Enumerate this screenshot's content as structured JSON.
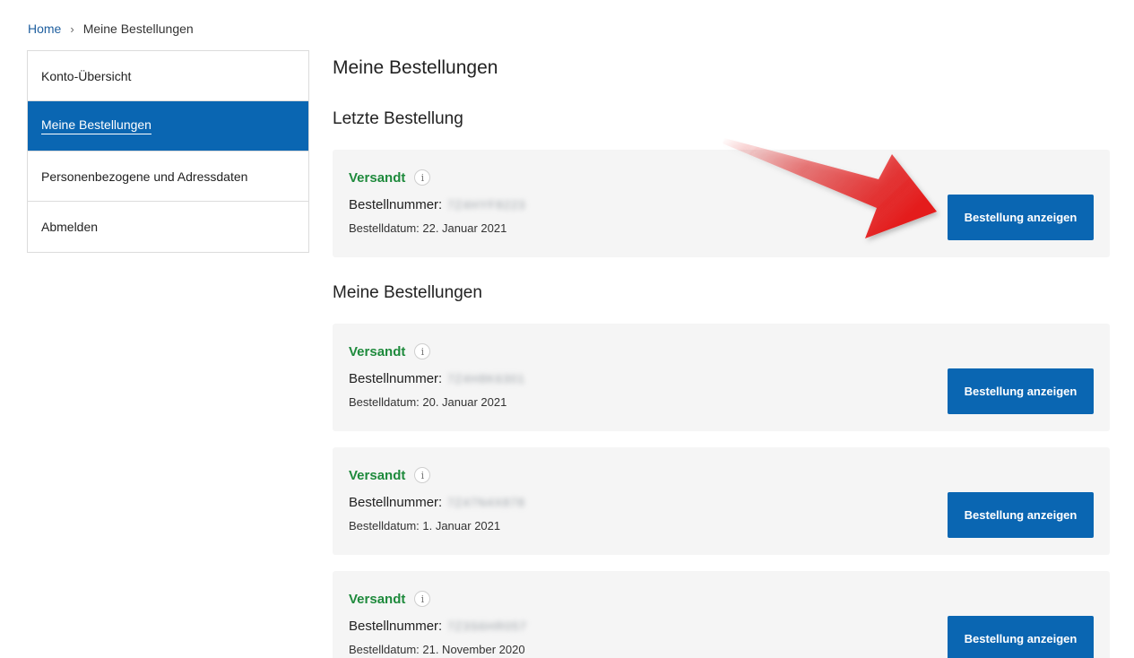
{
  "breadcrumb": {
    "home": "Home",
    "separator": "›",
    "current": "Meine Bestellungen"
  },
  "sidebar": {
    "items": [
      {
        "label": "Konto-Übersicht",
        "active": false
      },
      {
        "label": "Meine Bestellungen",
        "active": true
      },
      {
        "label": "Personenbezogene und Adressdaten",
        "active": false
      },
      {
        "label": "Abmelden",
        "active": false
      }
    ]
  },
  "main": {
    "title": "Meine Bestellungen",
    "latest_section_title": "Letzte Bestellung",
    "orders_section_title": "Meine Bestellungen",
    "latest_order": {
      "status": "Versandt",
      "number_label": "Bestellnummer:",
      "number_value": "7Z4HYF8223",
      "date": "Bestelldatum: 22. Januar 2021",
      "button_label": "Bestellung anzeigen"
    },
    "orders": [
      {
        "status": "Versandt",
        "number_label": "Bestellnummer:",
        "number_value": "7Z4H8K6301",
        "date": "Bestelldatum: 20. Januar 2021",
        "button_label": "Bestellung anzeigen"
      },
      {
        "status": "Versandt",
        "number_label": "Bestellnummer:",
        "number_value": "7Z47N4X878",
        "date": "Bestelldatum: 1. Januar 2021",
        "button_label": "Bestellung anzeigen"
      },
      {
        "status": "Versandt",
        "number_label": "Bestellnummer:",
        "number_value": "7Z3S6HR057",
        "date": "Bestelldatum: 21. November 2020",
        "button_label": "Bestellung anzeigen"
      }
    ]
  },
  "icons": {
    "info": "info-icon",
    "annotation": "red-arrow-icon"
  },
  "colors": {
    "accent": "#0a66b2",
    "status_shipped": "#1e8a3c",
    "card_bg": "#f5f5f5",
    "arrow": "#e41b1b"
  },
  "info_glyph": "i"
}
